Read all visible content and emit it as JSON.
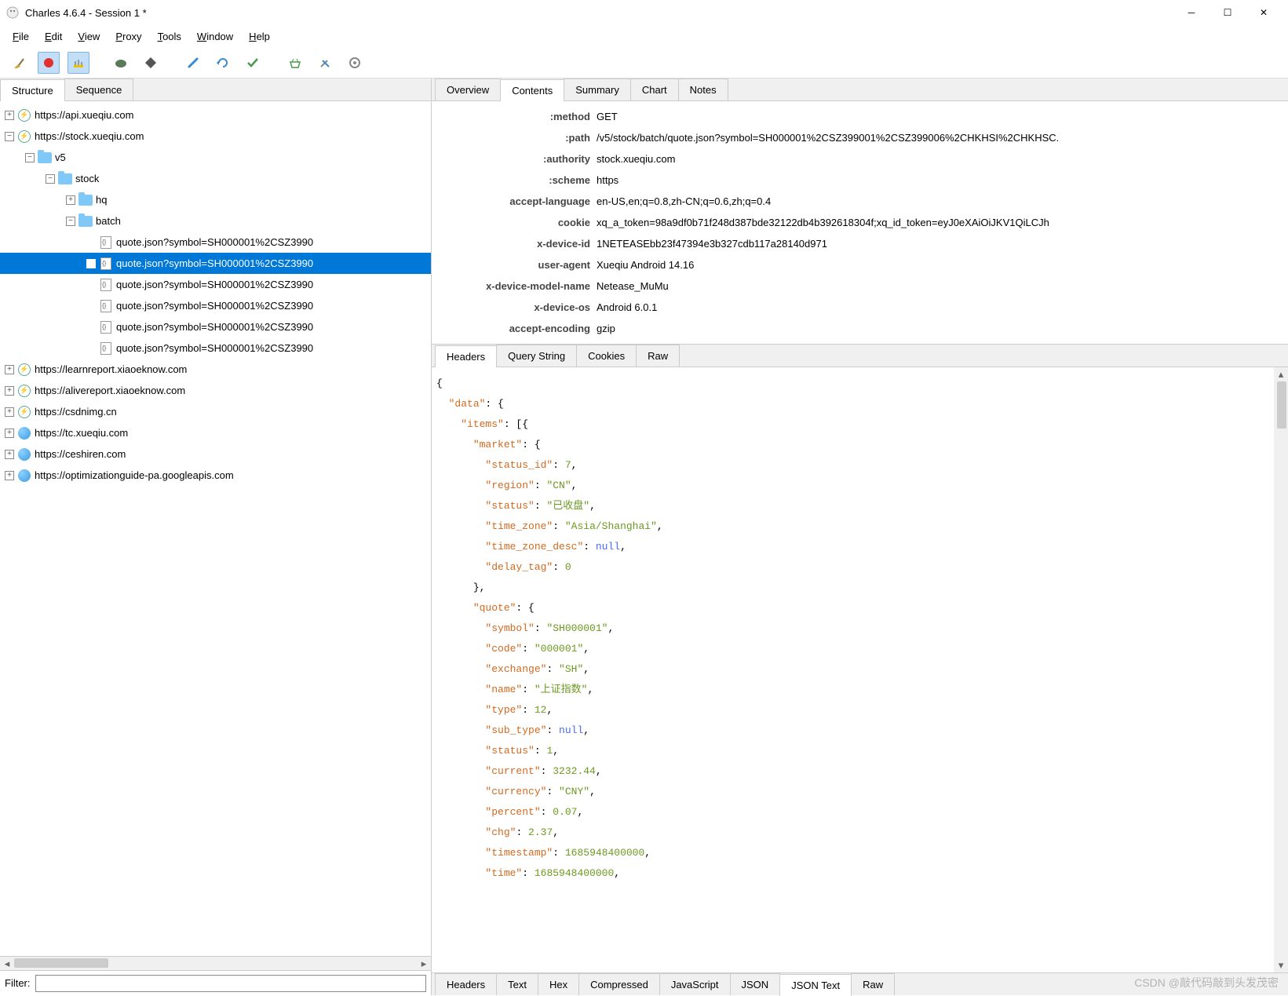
{
  "window": {
    "title": "Charles 4.6.4 - Session 1 *"
  },
  "menu": {
    "file": "File",
    "edit": "Edit",
    "view": "View",
    "proxy": "Proxy",
    "tools": "Tools",
    "window": "Window",
    "help": "Help"
  },
  "left_tabs": {
    "structure": "Structure",
    "sequence": "Sequence"
  },
  "tree": {
    "hosts": [
      {
        "type": "host",
        "icon": "lock",
        "exp": "+",
        "label": "https://api.xueqiu.com"
      },
      {
        "type": "host",
        "icon": "lock",
        "exp": "-",
        "label": "https://stock.xueqiu.com",
        "children": [
          {
            "type": "folder",
            "exp": "-",
            "label": "v5",
            "children": [
              {
                "type": "folder",
                "exp": "-",
                "label": "stock",
                "children": [
                  {
                    "type": "folder",
                    "exp": "+",
                    "label": "hq"
                  },
                  {
                    "type": "folder",
                    "exp": "-",
                    "label": "batch",
                    "children": [
                      {
                        "type": "file",
                        "label": "quote.json?symbol=SH000001%2CSZ3990"
                      },
                      {
                        "type": "file",
                        "label": "quote.json?symbol=SH000001%2CSZ3990",
                        "selected": true
                      },
                      {
                        "type": "file",
                        "label": "quote.json?symbol=SH000001%2CSZ3990"
                      },
                      {
                        "type": "file",
                        "label": "quote.json?symbol=SH000001%2CSZ3990"
                      },
                      {
                        "type": "file",
                        "label": "quote.json?symbol=SH000001%2CSZ3990"
                      },
                      {
                        "type": "file",
                        "label": "quote.json?symbol=SH000001%2CSZ3990"
                      }
                    ]
                  }
                ]
              }
            ]
          }
        ]
      },
      {
        "type": "host",
        "icon": "lock",
        "exp": "+",
        "label": "https://learnreport.xiaoeknow.com"
      },
      {
        "type": "host",
        "icon": "lock",
        "exp": "+",
        "label": "https://alivereport.xiaoeknow.com"
      },
      {
        "type": "host",
        "icon": "lock",
        "exp": "+",
        "label": "https://csdnimg.cn"
      },
      {
        "type": "host",
        "icon": "globe",
        "exp": "+",
        "label": "https://tc.xueqiu.com"
      },
      {
        "type": "host",
        "icon": "globe",
        "exp": "+",
        "label": "https://ceshiren.com"
      },
      {
        "type": "host",
        "icon": "globe",
        "exp": "+",
        "label": "https://optimizationguide-pa.googleapis.com"
      }
    ]
  },
  "filter": {
    "label": "Filter:",
    "value": ""
  },
  "right_tabs": {
    "overview": "Overview",
    "contents": "Contents",
    "summary": "Summary",
    "chart": "Chart",
    "notes": "Notes"
  },
  "request_headers": [
    {
      "key": ":method",
      "value": "GET"
    },
    {
      "key": ":path",
      "value": "/v5/stock/batch/quote.json?symbol=SH000001%2CSZ399001%2CSZ399006%2CHKHSI%2CHKHSC."
    },
    {
      "key": ":authority",
      "value": "stock.xueqiu.com"
    },
    {
      "key": ":scheme",
      "value": "https"
    },
    {
      "key": "accept-language",
      "value": "en-US,en;q=0.8,zh-CN;q=0.6,zh;q=0.4"
    },
    {
      "key": "cookie",
      "value": "xq_a_token=98a9df0b71f248d387bde32122db4b392618304f;xq_id_token=eyJ0eXAiOiJKV1QiLCJh"
    },
    {
      "key": "x-device-id",
      "value": "1NETEASEbb23f47394e3b327cdb117a28140d971"
    },
    {
      "key": "user-agent",
      "value": "Xueqiu Android 14.16"
    },
    {
      "key": "x-device-model-name",
      "value": "Netease_MuMu"
    },
    {
      "key": "x-device-os",
      "value": "Android 6.0.1"
    },
    {
      "key": "accept-encoding",
      "value": "gzip"
    }
  ],
  "sub_tabs": {
    "headers": "Headers",
    "query": "Query String",
    "cookies": "Cookies",
    "raw": "Raw"
  },
  "json_body_lines": [
    {
      "indent": 0,
      "tokens": [
        {
          "t": "p",
          "v": "{"
        }
      ]
    },
    {
      "indent": 1,
      "tokens": [
        {
          "t": "k",
          "v": "\"data\""
        },
        {
          "t": "p",
          "v": ": {"
        }
      ]
    },
    {
      "indent": 2,
      "tokens": [
        {
          "t": "k",
          "v": "\"items\""
        },
        {
          "t": "p",
          "v": ": [{"
        }
      ]
    },
    {
      "indent": 3,
      "tokens": [
        {
          "t": "k",
          "v": "\"market\""
        },
        {
          "t": "p",
          "v": ": {"
        }
      ]
    },
    {
      "indent": 4,
      "tokens": [
        {
          "t": "k",
          "v": "\"status_id\""
        },
        {
          "t": "p",
          "v": ": "
        },
        {
          "t": "n",
          "v": "7"
        },
        {
          "t": "p",
          "v": ","
        }
      ]
    },
    {
      "indent": 4,
      "tokens": [
        {
          "t": "k",
          "v": "\"region\""
        },
        {
          "t": "p",
          "v": ": "
        },
        {
          "t": "s",
          "v": "\"CN\""
        },
        {
          "t": "p",
          "v": ","
        }
      ]
    },
    {
      "indent": 4,
      "tokens": [
        {
          "t": "k",
          "v": "\"status\""
        },
        {
          "t": "p",
          "v": ": "
        },
        {
          "t": "s",
          "v": "\"已收盘\""
        },
        {
          "t": "p",
          "v": ","
        }
      ]
    },
    {
      "indent": 4,
      "tokens": [
        {
          "t": "k",
          "v": "\"time_zone\""
        },
        {
          "t": "p",
          "v": ": "
        },
        {
          "t": "s",
          "v": "\"Asia/Shanghai\""
        },
        {
          "t": "p",
          "v": ","
        }
      ]
    },
    {
      "indent": 4,
      "tokens": [
        {
          "t": "k",
          "v": "\"time_zone_desc\""
        },
        {
          "t": "p",
          "v": ": "
        },
        {
          "t": "nl",
          "v": "null"
        },
        {
          "t": "p",
          "v": ","
        }
      ]
    },
    {
      "indent": 4,
      "tokens": [
        {
          "t": "k",
          "v": "\"delay_tag\""
        },
        {
          "t": "p",
          "v": ": "
        },
        {
          "t": "n",
          "v": "0"
        }
      ]
    },
    {
      "indent": 3,
      "tokens": [
        {
          "t": "p",
          "v": "},"
        }
      ]
    },
    {
      "indent": 3,
      "tokens": [
        {
          "t": "k",
          "v": "\"quote\""
        },
        {
          "t": "p",
          "v": ": {"
        }
      ]
    },
    {
      "indent": 4,
      "tokens": [
        {
          "t": "k",
          "v": "\"symbol\""
        },
        {
          "t": "p",
          "v": ": "
        },
        {
          "t": "s",
          "v": "\"SH000001\""
        },
        {
          "t": "p",
          "v": ","
        }
      ]
    },
    {
      "indent": 4,
      "tokens": [
        {
          "t": "k",
          "v": "\"code\""
        },
        {
          "t": "p",
          "v": ": "
        },
        {
          "t": "s",
          "v": "\"000001\""
        },
        {
          "t": "p",
          "v": ","
        }
      ]
    },
    {
      "indent": 4,
      "tokens": [
        {
          "t": "k",
          "v": "\"exchange\""
        },
        {
          "t": "p",
          "v": ": "
        },
        {
          "t": "s",
          "v": "\"SH\""
        },
        {
          "t": "p",
          "v": ","
        }
      ]
    },
    {
      "indent": 4,
      "tokens": [
        {
          "t": "k",
          "v": "\"name\""
        },
        {
          "t": "p",
          "v": ": "
        },
        {
          "t": "s",
          "v": "\"上证指数\""
        },
        {
          "t": "p",
          "v": ","
        }
      ]
    },
    {
      "indent": 4,
      "tokens": [
        {
          "t": "k",
          "v": "\"type\""
        },
        {
          "t": "p",
          "v": ": "
        },
        {
          "t": "n",
          "v": "12"
        },
        {
          "t": "p",
          "v": ","
        }
      ]
    },
    {
      "indent": 4,
      "tokens": [
        {
          "t": "k",
          "v": "\"sub_type\""
        },
        {
          "t": "p",
          "v": ": "
        },
        {
          "t": "nl",
          "v": "null"
        },
        {
          "t": "p",
          "v": ","
        }
      ]
    },
    {
      "indent": 4,
      "tokens": [
        {
          "t": "k",
          "v": "\"status\""
        },
        {
          "t": "p",
          "v": ": "
        },
        {
          "t": "n",
          "v": "1"
        },
        {
          "t": "p",
          "v": ","
        }
      ]
    },
    {
      "indent": 4,
      "tokens": [
        {
          "t": "k",
          "v": "\"current\""
        },
        {
          "t": "p",
          "v": ": "
        },
        {
          "t": "n",
          "v": "3232.44"
        },
        {
          "t": "p",
          "v": ","
        }
      ]
    },
    {
      "indent": 4,
      "tokens": [
        {
          "t": "k",
          "v": "\"currency\""
        },
        {
          "t": "p",
          "v": ": "
        },
        {
          "t": "s",
          "v": "\"CNY\""
        },
        {
          "t": "p",
          "v": ","
        }
      ]
    },
    {
      "indent": 4,
      "tokens": [
        {
          "t": "k",
          "v": "\"percent\""
        },
        {
          "t": "p",
          "v": ": "
        },
        {
          "t": "n",
          "v": "0.07"
        },
        {
          "t": "p",
          "v": ","
        }
      ]
    },
    {
      "indent": 4,
      "tokens": [
        {
          "t": "k",
          "v": "\"chg\""
        },
        {
          "t": "p",
          "v": ": "
        },
        {
          "t": "n",
          "v": "2.37"
        },
        {
          "t": "p",
          "v": ","
        }
      ]
    },
    {
      "indent": 4,
      "tokens": [
        {
          "t": "k",
          "v": "\"timestamp\""
        },
        {
          "t": "p",
          "v": ": "
        },
        {
          "t": "n",
          "v": "1685948400000"
        },
        {
          "t": "p",
          "v": ","
        }
      ]
    },
    {
      "indent": 4,
      "tokens": [
        {
          "t": "k",
          "v": "\"time\""
        },
        {
          "t": "p",
          "v": ": "
        },
        {
          "t": "n",
          "v": "1685948400000"
        },
        {
          "t": "p",
          "v": ","
        }
      ]
    }
  ],
  "bottom_tabs": {
    "headers": "Headers",
    "text": "Text",
    "hex": "Hex",
    "compressed": "Compressed",
    "javascript": "JavaScript",
    "json": "JSON",
    "jsontext": "JSON Text",
    "raw": "Raw"
  },
  "watermark": "CSDN @敲代码敲到头发茂密"
}
